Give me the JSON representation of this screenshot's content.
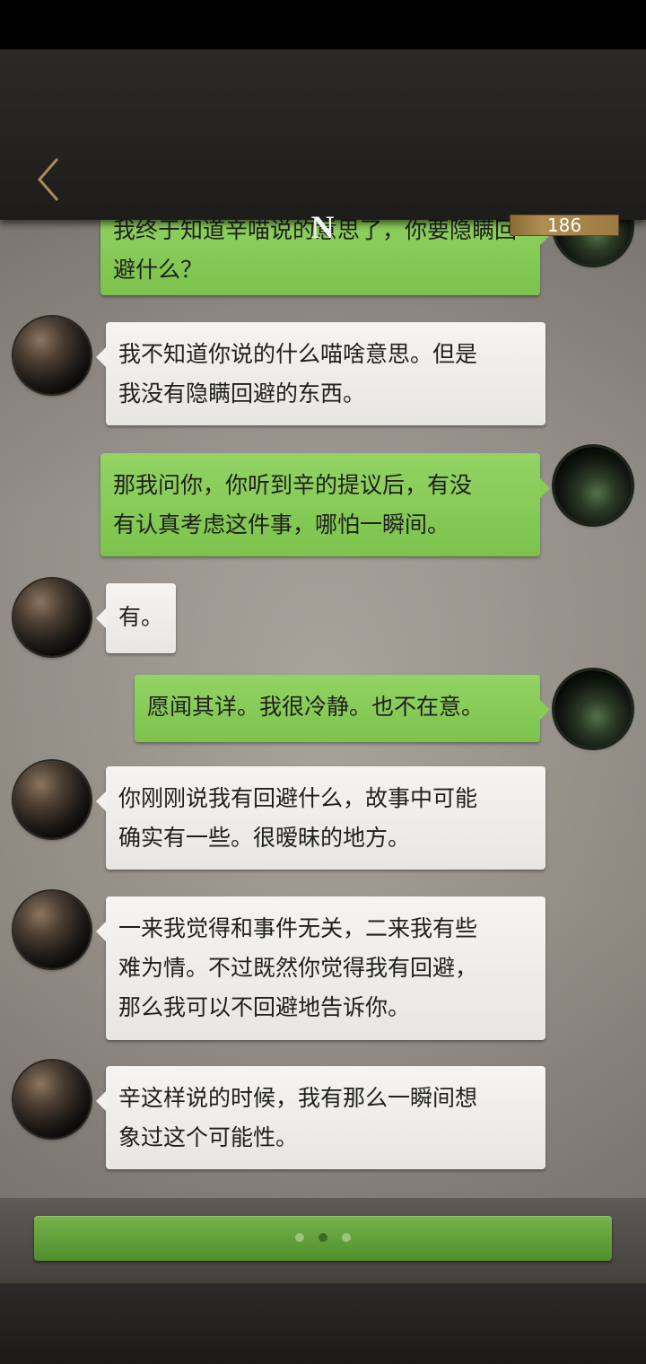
{
  "header": {
    "title": "N",
    "counter": "186",
    "accent_color": "#b08d52"
  },
  "messages": [
    {
      "sender": "me",
      "text": "我终于知道辛喵说的意思了，你要隐瞒回避什么？"
    },
    {
      "sender": "other",
      "text": "我不知道你说的什么喵啥意思。但是\n我没有隐瞒回避的东西。"
    },
    {
      "sender": "me",
      "text": "那我问你，你听到辛的提议后，有没\n有认真考虑这件事，哪怕一瞬间。"
    },
    {
      "sender": "other",
      "text": "有。"
    },
    {
      "sender": "me",
      "text": "愿闻其详。我很冷静。也不在意。"
    },
    {
      "sender": "other",
      "text": "你刚刚说我有回避什么，故事中可能\n确实有一些。很暧昧的地方。"
    },
    {
      "sender": "other",
      "text": "一来我觉得和事件无关，二来我有些\n难为情。不过既然你觉得我有回避，\n那么我可以不回避地告诉你。"
    },
    {
      "sender": "other",
      "text": "辛这样说的时候，我有那么一瞬间想\n象过这个可能性。"
    }
  ],
  "typing_indicator": {
    "dots": 3,
    "active_index": 1
  },
  "colors": {
    "my_bubble": "#88cc58",
    "their_bubble": "#f2f1ed",
    "continue_button": "#62a03b"
  }
}
